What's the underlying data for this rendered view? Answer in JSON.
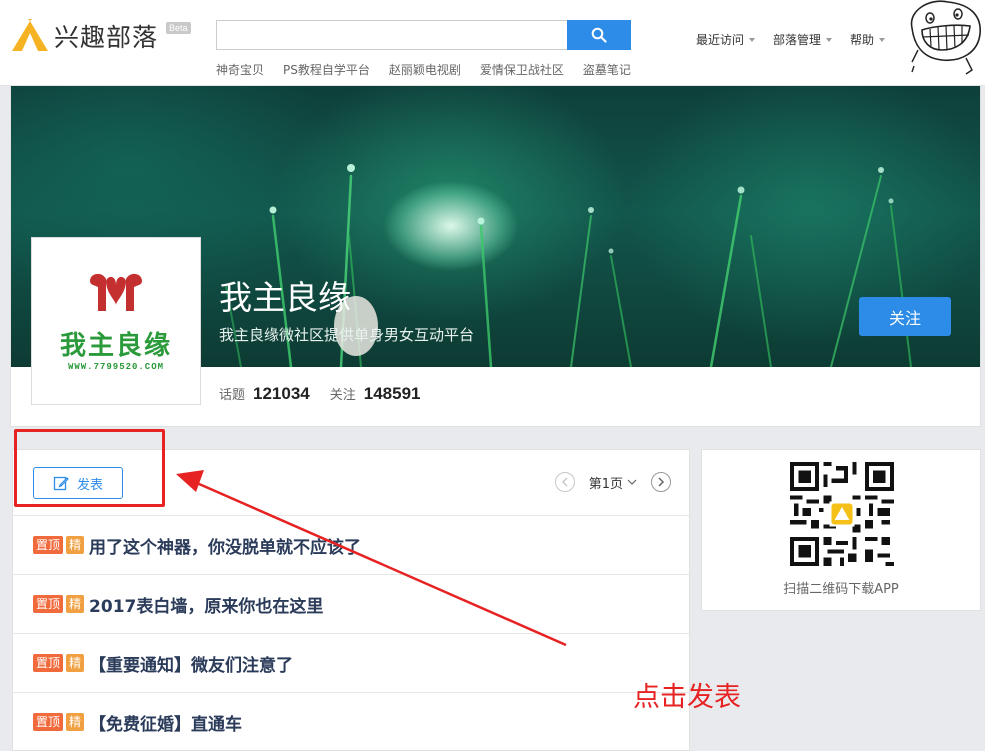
{
  "header": {
    "logo_text": "兴趣部落",
    "beta": "Beta",
    "search": {
      "value": "",
      "placeholder": ""
    },
    "hot_links": [
      "神奇宝贝",
      "PS教程自学平台",
      "赵丽颖电视剧",
      "爱情保卫战社区",
      "盗墓笔记"
    ],
    "nav": [
      {
        "label": "最近访问"
      },
      {
        "label": "部落管理"
      },
      {
        "label": "帮助"
      }
    ]
  },
  "tribe": {
    "name": "我主良缘",
    "description": "我主良缘微社区提供单身男女互动平台",
    "logo_name": "我主良缘",
    "logo_url": "WWW.7799520.COM",
    "follow_label": "关注",
    "stats": [
      {
        "label": "话题",
        "value": "121034"
      },
      {
        "label": "关注",
        "value": "148591"
      }
    ]
  },
  "toolbar": {
    "post_label": "发表",
    "page_label": "第1页"
  },
  "topics": [
    {
      "top": "置顶",
      "essence": "精",
      "title": "用了这个神器，你没脱单就不应该了"
    },
    {
      "top": "置顶",
      "essence": "精",
      "title": "2017表白墙，原来你也在这里"
    },
    {
      "top": "置顶",
      "essence": "精",
      "title": "【重要通知】微友们注意了"
    },
    {
      "top": "置顶",
      "essence": "精",
      "title": "【免费征婚】直通车"
    }
  ],
  "qr": {
    "caption": "扫描二维码下载APP"
  },
  "annotation": {
    "text": "点击发表"
  },
  "colors": {
    "accent": "#2d8ce8",
    "annotation": "#e62222",
    "badge_top": "#f06a3c",
    "badge_essence": "#f0a040"
  }
}
